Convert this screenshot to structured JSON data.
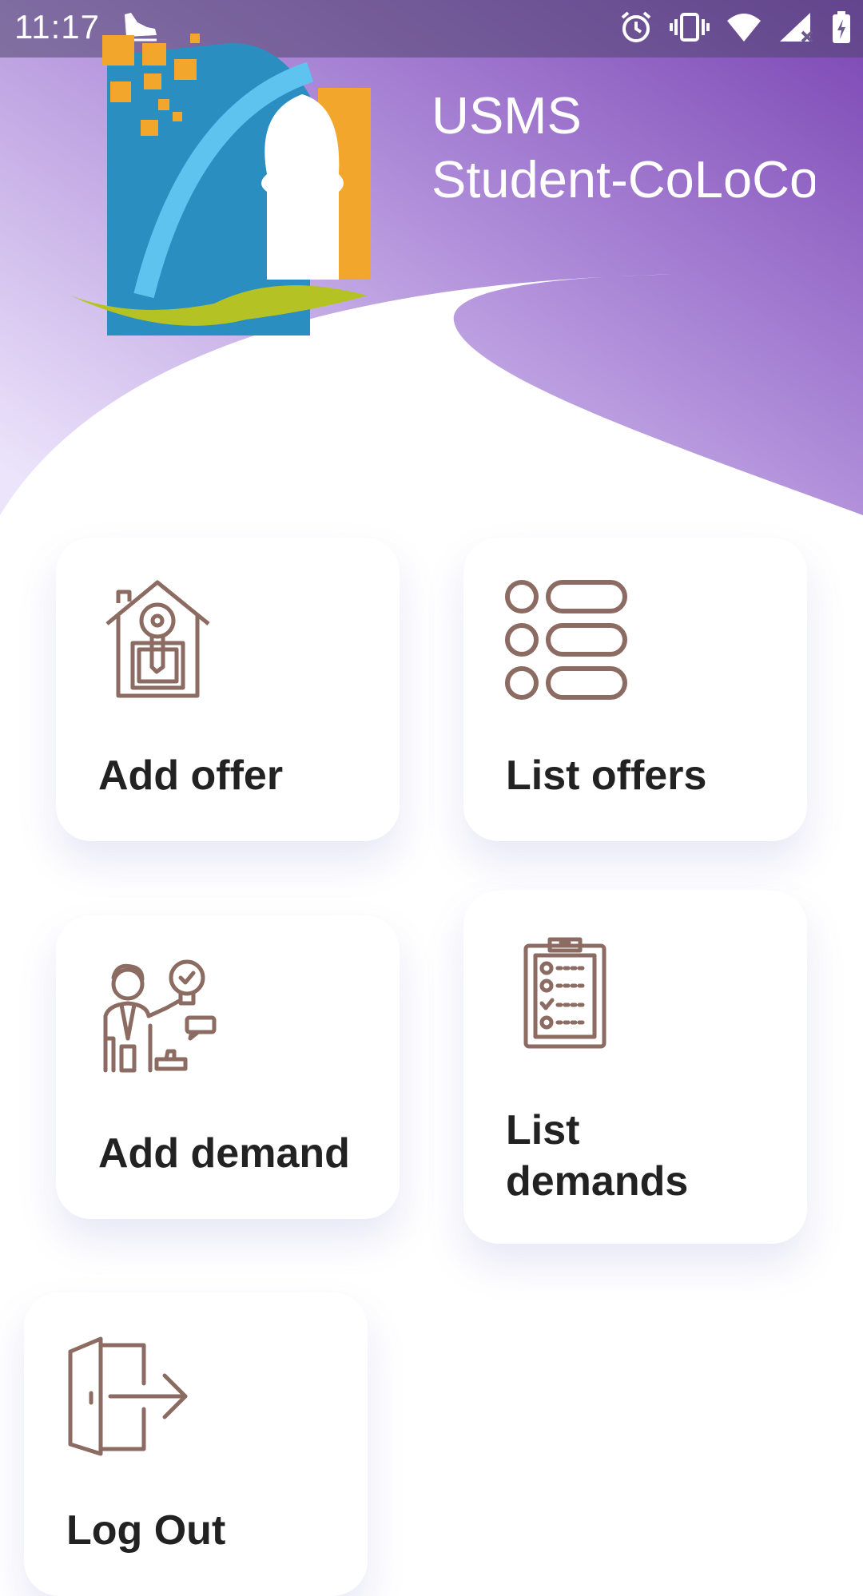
{
  "status_bar": {
    "time": "11:17",
    "icons": [
      "shoe-icon",
      "alarm-icon",
      "vibrate-icon",
      "wifi-icon",
      "signal-icon",
      "battery-icon"
    ]
  },
  "header": {
    "title_line1": "USMS",
    "title_line2": "Student-CoLoCo",
    "gradient_colors": [
      "#ece4fb",
      "#ad8ad8",
      "#7a45b3"
    ]
  },
  "menu": {
    "add_offer": {
      "label": "Add offer",
      "icon": "house-key-icon"
    },
    "list_offers": {
      "label": "List offers",
      "icon": "list-icon"
    },
    "add_demand": {
      "label": "Add demand",
      "icon": "person-idea-icon"
    },
    "list_demands": {
      "label": "List\ndemands",
      "icon": "clipboard-checklist-icon"
    },
    "log_out": {
      "label": "Log Out",
      "icon": "logout-door-icon"
    }
  },
  "colors": {
    "icon_stroke": "#8b6b62",
    "label_text": "#222222",
    "card_background": "#ffffff"
  }
}
